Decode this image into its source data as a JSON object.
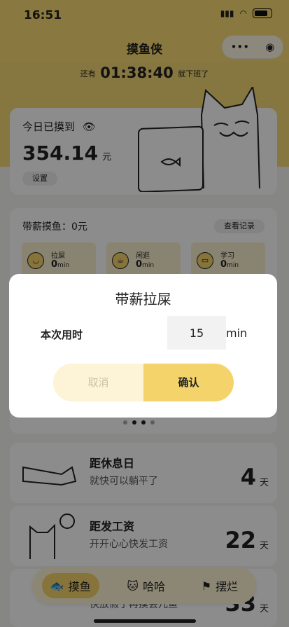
{
  "status_bar": {
    "time": "16:51"
  },
  "app": {
    "title": "摸鱼侠"
  },
  "countdown": {
    "prefix": "还有",
    "value": "01:38:40",
    "suffix": "就下班了"
  },
  "today": {
    "label": "今日已摸到",
    "amount": "354.14",
    "unit": "元",
    "setting_button": "设置"
  },
  "paid": {
    "label": "带薪摸鱼：0元",
    "record_button": "查看记录",
    "tiles": [
      {
        "label": "拉屎",
        "value": "0",
        "unit": "min"
      },
      {
        "label": "闲逛",
        "value": "0",
        "unit": "min"
      },
      {
        "label": "学习",
        "value": "0",
        "unit": "min"
      }
    ]
  },
  "countdowns": [
    {
      "title": "距休息日",
      "subtitle": "就快可以躺平了",
      "number": "4",
      "unit": "天"
    },
    {
      "title": "距发工资",
      "subtitle": "开开心心快发工资",
      "number": "22",
      "unit": "天"
    },
    {
      "title": "",
      "subtitle": "快放假了再摸会儿鱼",
      "number": "33",
      "unit": "天"
    }
  ],
  "tabbar": {
    "items": [
      "摸鱼",
      "哈哈",
      "摆烂"
    ]
  },
  "modal": {
    "title": "带薪拉屎",
    "label": "本次用时",
    "value": "15",
    "unit": "min",
    "cancel": "取消",
    "confirm": "确认"
  },
  "colors": {
    "brand_yellow": "#f9dd75",
    "accent": "#f4d36a"
  }
}
